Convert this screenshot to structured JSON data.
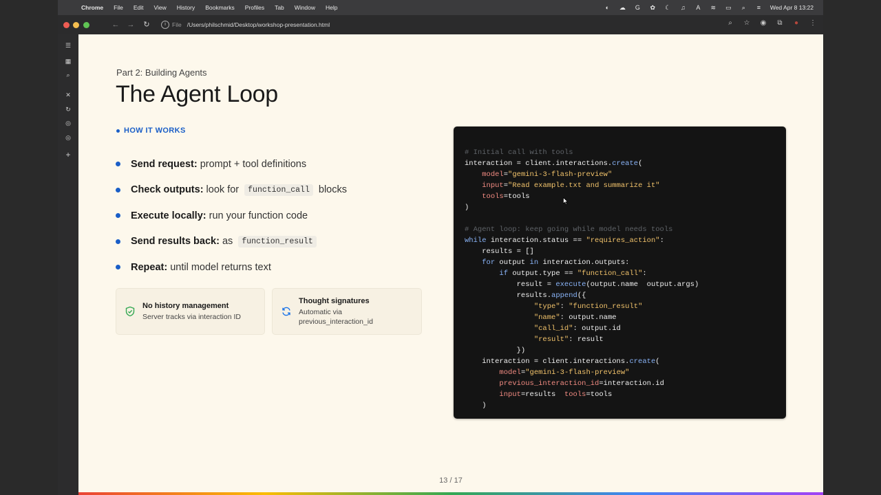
{
  "menubar": {
    "app": "Chrome",
    "items": [
      "File",
      "Edit",
      "View",
      "History",
      "Bookmarks",
      "Profiles",
      "Tab",
      "Window",
      "Help"
    ],
    "datetime": "Wed Apr 8  13:22"
  },
  "browser": {
    "file_chip": "File",
    "url": "/Users/philschmid/Desktop/workshop-presentation.html"
  },
  "slide": {
    "subtitle": "Part 2: Building Agents",
    "title": "The Agent Loop",
    "section_label": "HOW IT WORKS",
    "steps": [
      {
        "label": "Send request:",
        "text": " prompt + tool definitions",
        "code": "",
        "after": ""
      },
      {
        "label": "Check outputs:",
        "text": " look for ",
        "code": "function_call",
        "after": " blocks"
      },
      {
        "label": "Execute locally:",
        "text": " run your function code",
        "code": "",
        "after": ""
      },
      {
        "label": "Send results back:",
        "text": " as ",
        "code": "function_result",
        "after": ""
      },
      {
        "label": "Repeat:",
        "text": " until model returns text",
        "code": "",
        "after": ""
      }
    ],
    "cards": [
      {
        "title": "No history management",
        "desc": "Server tracks via interaction ID",
        "icon": "shield-check-icon"
      },
      {
        "title": "Thought signatures",
        "desc": "Automatic via previous_interaction_id",
        "icon": "sync-icon"
      }
    ],
    "page_number": "13 / 17"
  },
  "code": {
    "lines": [
      [
        {
          "t": "# Initial call with tools",
          "c": "c-comment"
        }
      ],
      [
        {
          "t": "interaction = client.interactions.",
          "c": "c-plain"
        },
        {
          "t": "create",
          "c": "c-kw"
        },
        {
          "t": "(",
          "c": "c-plain"
        }
      ],
      [
        {
          "t": "    ",
          "c": "c-plain"
        },
        {
          "t": "model",
          "c": "c-kwarg"
        },
        {
          "t": "=",
          "c": "c-plain"
        },
        {
          "t": "\"gemini-3-flash-preview\"",
          "c": "c-str"
        }
      ],
      [
        {
          "t": "    ",
          "c": "c-plain"
        },
        {
          "t": "input",
          "c": "c-kwarg"
        },
        {
          "t": "=",
          "c": "c-plain"
        },
        {
          "t": "\"Read example.txt and summarize it\"",
          "c": "c-str"
        }
      ],
      [
        {
          "t": "    ",
          "c": "c-plain"
        },
        {
          "t": "tools",
          "c": "c-kwarg"
        },
        {
          "t": "=tools",
          "c": "c-plain"
        }
      ],
      [
        {
          "t": ")",
          "c": "c-plain"
        }
      ],
      [
        {
          "t": "",
          "c": "c-plain"
        }
      ],
      [
        {
          "t": "# Agent loop: keep going while model needs tools",
          "c": "c-comment"
        }
      ],
      [
        {
          "t": "while",
          "c": "c-kw"
        },
        {
          "t": " interaction.status == ",
          "c": "c-plain"
        },
        {
          "t": "\"requires_action\"",
          "c": "c-str"
        },
        {
          "t": ":",
          "c": "c-plain"
        }
      ],
      [
        {
          "t": "    results = []",
          "c": "c-plain"
        }
      ],
      [
        {
          "t": "    ",
          "c": "c-plain"
        },
        {
          "t": "for",
          "c": "c-kw"
        },
        {
          "t": " output ",
          "c": "c-plain"
        },
        {
          "t": "in",
          "c": "c-kw"
        },
        {
          "t": " interaction.outputs:",
          "c": "c-plain"
        }
      ],
      [
        {
          "t": "        ",
          "c": "c-plain"
        },
        {
          "t": "if",
          "c": "c-kw"
        },
        {
          "t": " output.type == ",
          "c": "c-plain"
        },
        {
          "t": "\"function_call\"",
          "c": "c-str"
        },
        {
          "t": ":",
          "c": "c-plain"
        }
      ],
      [
        {
          "t": "            result = ",
          "c": "c-plain"
        },
        {
          "t": "execute",
          "c": "c-kw"
        },
        {
          "t": "(output.name  output.args)",
          "c": "c-plain"
        }
      ],
      [
        {
          "t": "            results.",
          "c": "c-plain"
        },
        {
          "t": "append",
          "c": "c-kw"
        },
        {
          "t": "({",
          "c": "c-plain"
        }
      ],
      [
        {
          "t": "                ",
          "c": "c-plain"
        },
        {
          "t": "\"type\"",
          "c": "c-str"
        },
        {
          "t": ": ",
          "c": "c-plain"
        },
        {
          "t": "\"function_result\"",
          "c": "c-str"
        }
      ],
      [
        {
          "t": "                ",
          "c": "c-plain"
        },
        {
          "t": "\"name\"",
          "c": "c-str"
        },
        {
          "t": ": output.name",
          "c": "c-plain"
        }
      ],
      [
        {
          "t": "                ",
          "c": "c-plain"
        },
        {
          "t": "\"call_id\"",
          "c": "c-str"
        },
        {
          "t": ": output.id",
          "c": "c-plain"
        }
      ],
      [
        {
          "t": "                ",
          "c": "c-plain"
        },
        {
          "t": "\"result\"",
          "c": "c-str"
        },
        {
          "t": ": result",
          "c": "c-plain"
        }
      ],
      [
        {
          "t": "            })",
          "c": "c-plain"
        }
      ],
      [
        {
          "t": "    interaction = client.interactions.",
          "c": "c-plain"
        },
        {
          "t": "create",
          "c": "c-kw"
        },
        {
          "t": "(",
          "c": "c-plain"
        }
      ],
      [
        {
          "t": "        ",
          "c": "c-plain"
        },
        {
          "t": "model",
          "c": "c-kwarg"
        },
        {
          "t": "=",
          "c": "c-plain"
        },
        {
          "t": "\"gemini-3-flash-preview\"",
          "c": "c-str"
        }
      ],
      [
        {
          "t": "        ",
          "c": "c-plain"
        },
        {
          "t": "previous_interaction_id",
          "c": "c-kwarg"
        },
        {
          "t": "=interaction.id",
          "c": "c-plain"
        }
      ],
      [
        {
          "t": "        ",
          "c": "c-plain"
        },
        {
          "t": "input",
          "c": "c-kwarg"
        },
        {
          "t": "=results  ",
          "c": "c-plain"
        },
        {
          "t": "tools",
          "c": "c-kwarg"
        },
        {
          "t": "=tools",
          "c": "c-plain"
        }
      ],
      [
        {
          "t": "    )",
          "c": "c-plain"
        }
      ]
    ]
  }
}
